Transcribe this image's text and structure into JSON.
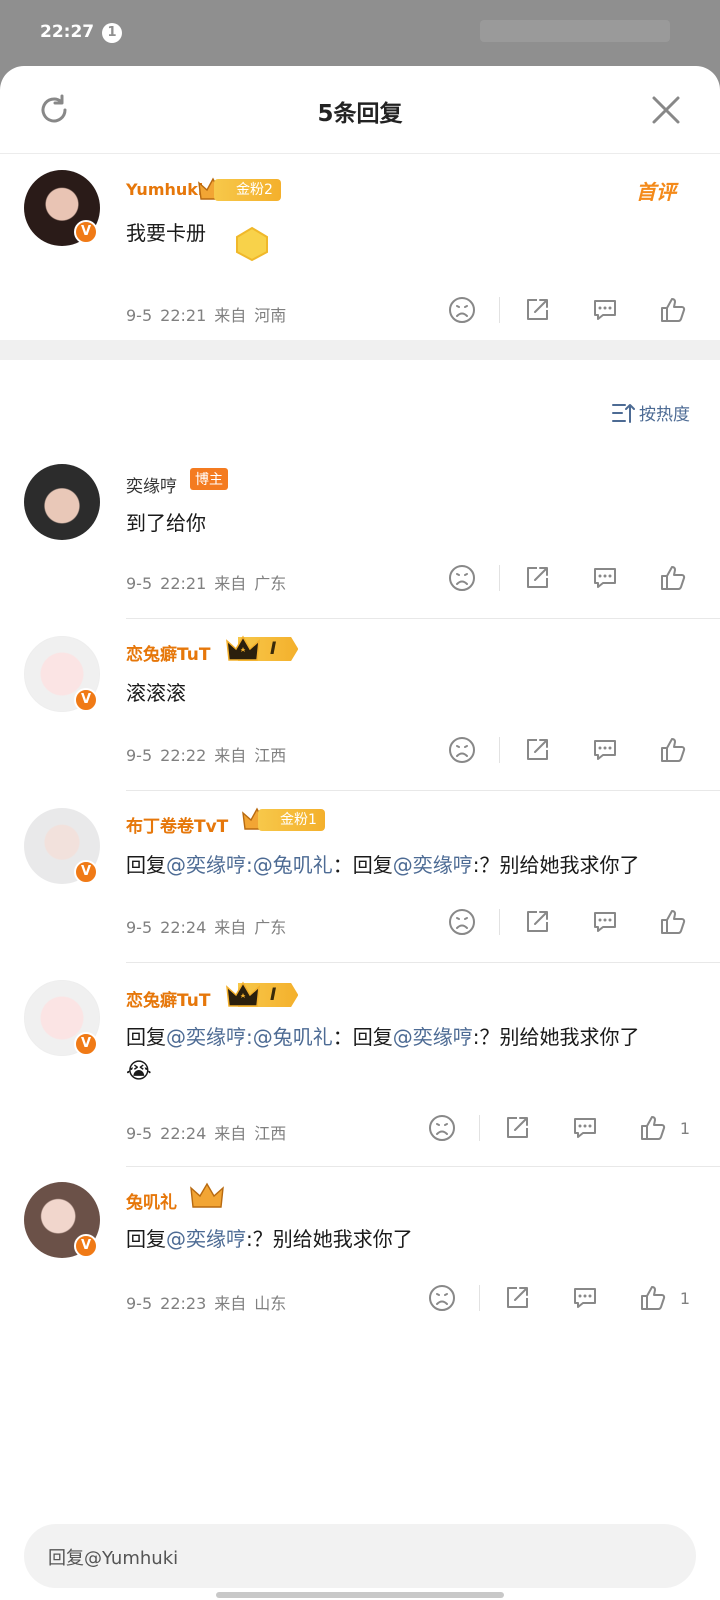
{
  "status_bar": {
    "time": "22:27",
    "notification_count": "1"
  },
  "header": {
    "title": "5条回复",
    "refresh_icon": "refresh-icon",
    "close_icon": "close-icon"
  },
  "root_comment": {
    "username": "Yumhuki",
    "fan_badge": "金粉2",
    "text": "我要卡册",
    "date": "9-5",
    "time": "22:21",
    "from_label": "来自",
    "location": "河南",
    "first_comment_tag": "首评",
    "like_count": ""
  },
  "sort": {
    "label": "按热度",
    "icon": "sort-icon"
  },
  "replies": [
    {
      "username": "奕缘哼",
      "blogger_badge": "博主",
      "text": "到了给你",
      "date": "9-5",
      "time": "22:21",
      "from_label": "来自",
      "location": "广东",
      "like_count": ""
    },
    {
      "username": "恋兔癖TuT",
      "level_badge": "I",
      "text": "滚滚滚",
      "date": "9-5",
      "time": "22:22",
      "from_label": "来自",
      "location": "江西",
      "like_count": ""
    },
    {
      "username": "布丁卷卷TvT",
      "fan_badge": "金粉1",
      "text_parts": [
        "回复",
        "@奕缘哼",
        ":",
        "@兔叽礼",
        "：回复",
        "@奕缘哼",
        ":？别给她我求你了"
      ],
      "date": "9-5",
      "time": "22:24",
      "from_label": "来自",
      "location": "广东",
      "like_count": ""
    },
    {
      "username": "恋兔癖TuT",
      "level_badge": "I",
      "text_parts": [
        "回复",
        "@奕缘哼",
        ":",
        "@兔叽礼",
        "：回复",
        "@奕缘哼",
        ":？别给她我求你了"
      ],
      "emoji": "😭",
      "date": "9-5",
      "time": "22:24",
      "from_label": "来自",
      "location": "江西",
      "like_count": "1"
    },
    {
      "username": "兔叽礼",
      "text_parts": [
        "回复",
        "@奕缘哼",
        ":？别给她我求你了"
      ],
      "date": "9-5",
      "time": "22:23",
      "from_label": "来自",
      "location": "山东",
      "like_count": "1"
    }
  ],
  "reply_input": {
    "placeholder": "回复@Yumhuki"
  },
  "colors": {
    "accent_orange": "#e6770a",
    "mention_blue": "#4d6b94",
    "verified_orange": "#f07a16"
  }
}
